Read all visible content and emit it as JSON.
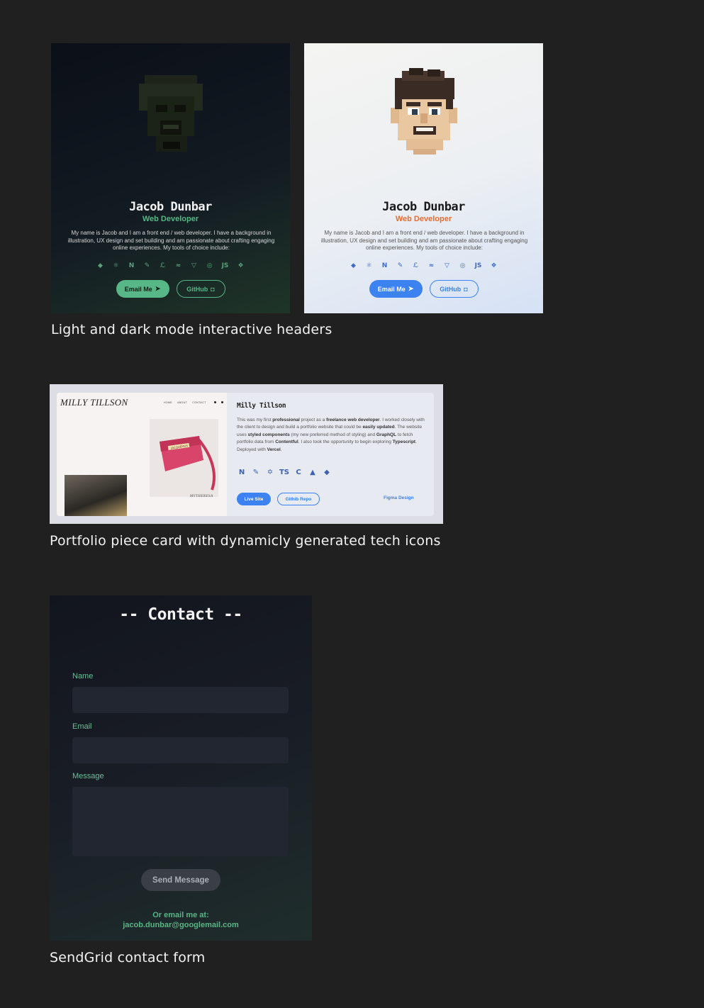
{
  "header_cards": {
    "name": "Jacob Dunbar",
    "role": "Web Developer",
    "bio": "My name is Jacob and I am a front end / web developer. I have a background in illustration, UX design and set building and am passionate about crafting engaging online experiences. My tools of choice include:",
    "email_button": "Email Me",
    "github_button": "GitHub",
    "tech_icons": [
      "git-icon",
      "react-icon",
      "nextjs-icon",
      "illustrator-icon",
      "sass-icon",
      "tailwind-icon",
      "vite-icon",
      "blender-icon",
      "javascript-icon",
      "figma-icon"
    ],
    "tech_glyphs": [
      "◆",
      "⚛",
      "N",
      "✎",
      "ℒ",
      "≈",
      "▽",
      "◎",
      "JS",
      "❖"
    ],
    "caption": "Light and dark mode interactive headers",
    "colors": {
      "dark_accent": "#57b787",
      "light_role": "#ee6a2c",
      "light_accent": "#3c82f0"
    }
  },
  "portfolio_card": {
    "screenshot_title": "MILLY TILLSON",
    "screenshot_nav": [
      "HOME",
      "ABOUT",
      "CONTACT"
    ],
    "screenshot_bag_brand": "JACQUEMUS",
    "screenshot_label": "MYTHERESA",
    "title": "Milly Tillson",
    "description": {
      "p1": "This was my first ",
      "b1": "professional",
      "p2": " project as a ",
      "b2": "freelance web developer",
      "p3": ". I worked closely with the client to design and build a portfolio website that could be ",
      "b3": "easily updated",
      "p4": ". The website uses ",
      "b4": "styled components",
      "p5": " (my new preferred method of styling) and ",
      "b5": "GraphQL",
      "p6": " to fetch portfolio data from ",
      "b6": "Contentful",
      "p7": ". I also took the opportunity to begin exploring ",
      "b7": "Typescript",
      "p8": ". Deployed with ",
      "b8": "Vercel",
      "p9": "."
    },
    "tech_icons": [
      "nextjs-icon",
      "illustrator-icon",
      "graphql-icon",
      "typescript-icon",
      "contentful-icon",
      "vercel-icon",
      "git-icon"
    ],
    "tech_glyphs": [
      "N",
      "✎",
      "✡",
      "TS",
      "C",
      "▲",
      "◆"
    ],
    "live_button": "Live Site",
    "repo_button": "Githib Repo",
    "figma_link": "Figma Design",
    "caption": "Portfolio piece card with dynamicly generated tech icons"
  },
  "contact_form": {
    "title": "-- Contact --",
    "name_label": "Name",
    "email_label": "Email",
    "message_label": "Message",
    "name_value": "",
    "email_value": "",
    "message_value": "",
    "send_button": "Send Message",
    "or_email": "Or email me at:",
    "email_address": "jacob.dunbar@googlemail.com",
    "caption": "SendGrid contact form"
  }
}
